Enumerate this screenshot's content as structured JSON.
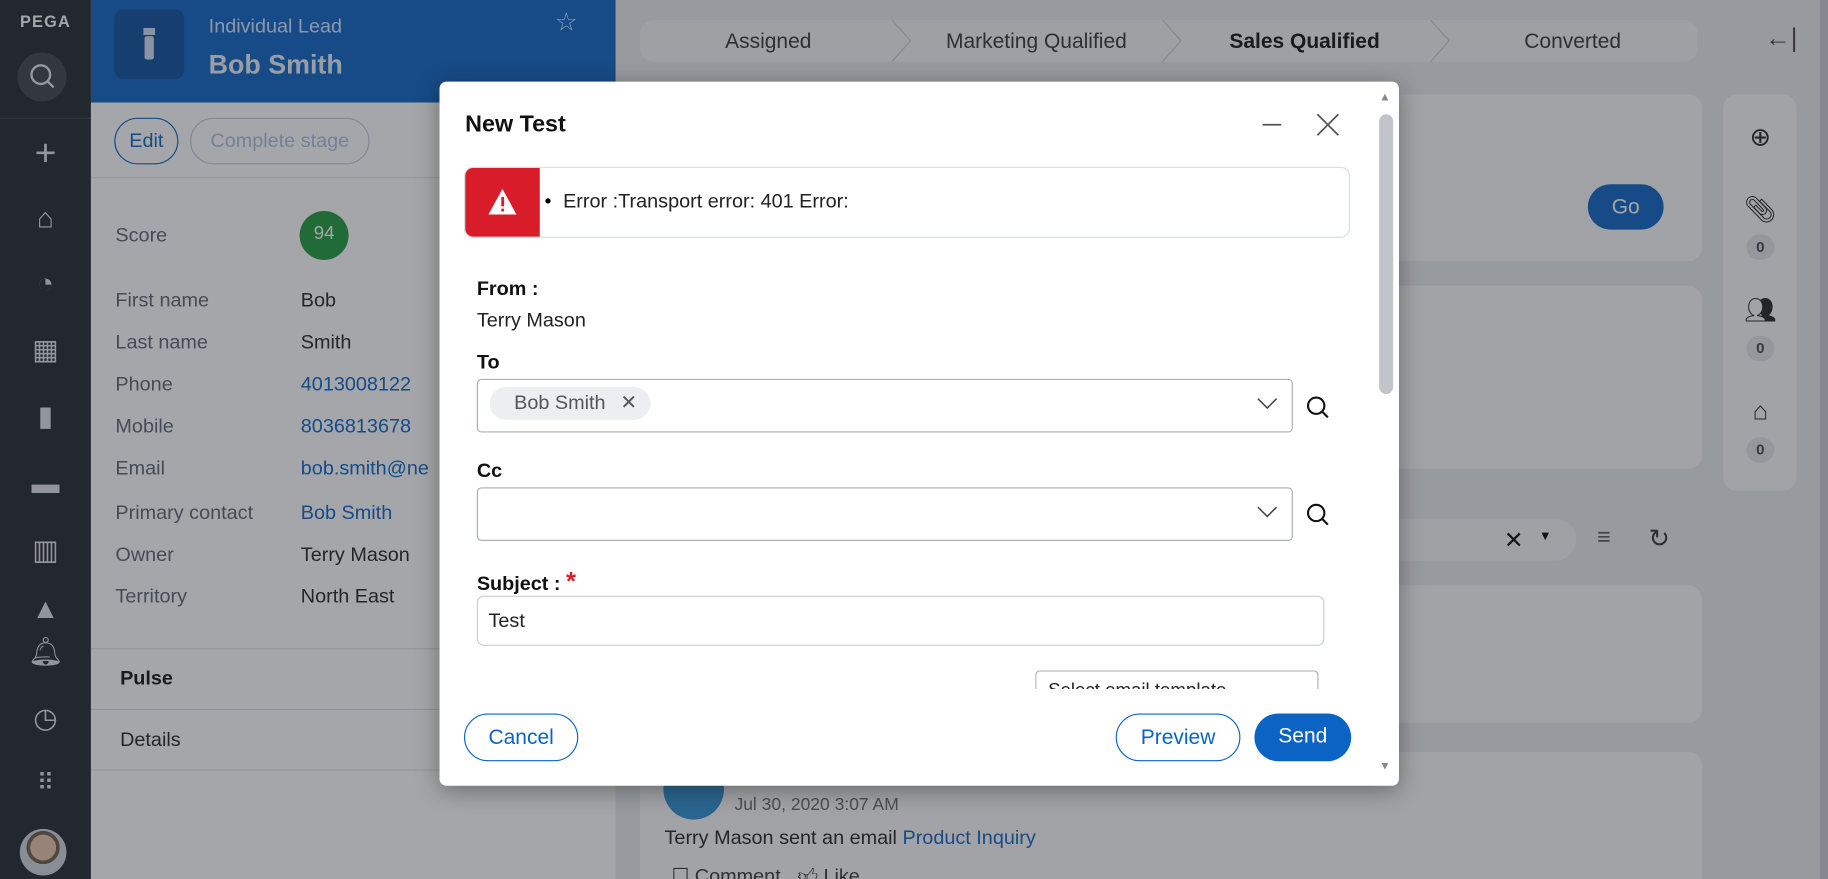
{
  "nav": {
    "logo": "PEGA",
    "icons": [
      "search-icon",
      "plus-icon",
      "home-icon",
      "dashboard-icon",
      "grid-icon",
      "tag-icon",
      "monitor-icon",
      "building-icon",
      "bell-icon",
      "history-icon",
      "apps-icon"
    ]
  },
  "header": {
    "type": "Individual Lead",
    "name": "Bob Smith"
  },
  "actions": {
    "edit": "Edit",
    "complete": "Complete stage"
  },
  "fields": [
    {
      "label": "First name",
      "value": "Bob",
      "link": false
    },
    {
      "label": "Last name",
      "value": "Smith",
      "link": false
    },
    {
      "label": "Phone",
      "value": "4013008122",
      "link": true
    },
    {
      "label": "Mobile",
      "value": "8036813678",
      "link": true
    },
    {
      "label": "Email",
      "value": "bob.smith@ne",
      "link": true
    },
    {
      "label": "Primary contact",
      "value": "Bob Smith",
      "link": true
    },
    {
      "label": "Owner",
      "value": "Terry Mason",
      "link": false
    },
    {
      "label": "Territory",
      "value": "North East",
      "link": false
    }
  ],
  "score": {
    "label": "Score",
    "value": "94"
  },
  "tabs": {
    "pulse": "Pulse",
    "details": "Details"
  },
  "stages": [
    "Assigned",
    "Marketing Qualified",
    "Sales Qualified",
    "Converted"
  ],
  "current_stage": "Sales Qualified",
  "main": {
    "go": "Go",
    "feed": {
      "date": "Jul 30, 2020 3:07 AM",
      "actor": "Terry Mason",
      "action": "sent an email",
      "link": "Product Inquiry",
      "comment": "Comment",
      "like": "Like"
    }
  },
  "rail": {
    "attachments": "0",
    "followers": "0",
    "tags": "0"
  },
  "dialog": {
    "title": "New Test",
    "error": "Error :Transport error: 401 Error:",
    "from_label": "From :",
    "from_value": "Terry Mason",
    "to_label": "To",
    "to_chip": "Bob Smith",
    "cc_label": "Cc",
    "subject_label": "Subject :",
    "required": "*",
    "subject_value": "Test",
    "template_placeholder": "Select email template",
    "cancel": "Cancel",
    "preview": "Preview",
    "send": "Send"
  },
  "colors": {
    "brand": "#0b63c4",
    "error": "#d91c2a",
    "score": "#1a9a3c",
    "nav": "#1e2530"
  }
}
